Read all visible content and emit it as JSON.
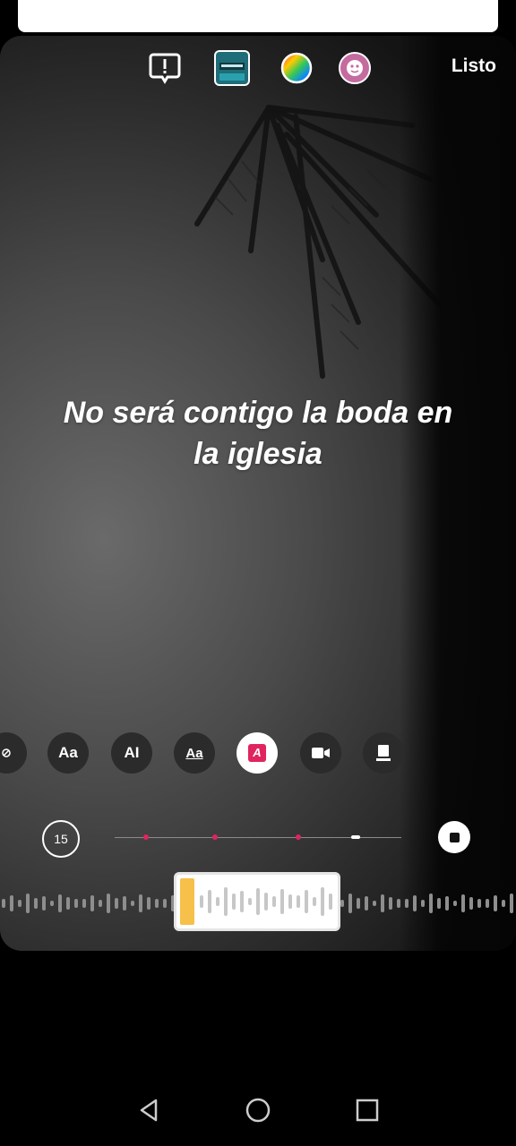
{
  "toolbar": {
    "done_label": "Listo",
    "icons": [
      "report-icon",
      "music-cover-icon",
      "color-wheel-icon",
      "effect-face-icon"
    ]
  },
  "story": {
    "text_line1": "No será contigo la boda en",
    "text_line2": "la iglesia"
  },
  "text_styles": {
    "items": [
      "no-style-icon",
      "Aa",
      "AI",
      "Aa",
      "A",
      "video-icon",
      "keep-icon"
    ],
    "labels": {
      "typewriter": "Aa",
      "bold": "AI",
      "underline": "Aa",
      "highlight": "A"
    }
  },
  "timeline": {
    "duration": "15",
    "markers": [
      0.11,
      0.35,
      0.64
    ],
    "current_position": 0.84
  },
  "colors": {
    "accent": "#e0245e",
    "handle": "#f7c04a"
  },
  "navbar": {
    "items": [
      "back-icon",
      "home-icon",
      "recents-icon"
    ]
  }
}
